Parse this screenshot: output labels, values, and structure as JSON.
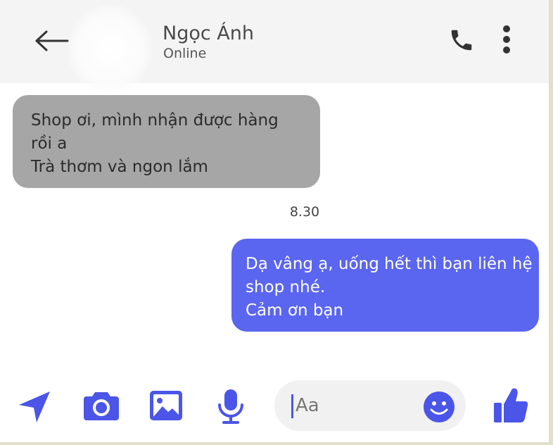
{
  "header": {
    "contact_name": "Ngọc Ánh",
    "status": "Online",
    "icons": [
      "back-arrow-icon",
      "phone-icon",
      "more-vertical-icon"
    ]
  },
  "messages": [
    {
      "direction": "incoming",
      "lines": [
        "Shop ơi, mình nhận được hàng",
        "rồi a",
        "Trà thơm và ngon lắm"
      ]
    },
    {
      "direction": "outgoing",
      "lines": [
        "Dạ vâng ạ, uống hết thì bạn liên hệ",
        "shop nhé.",
        "Cảm ơn bạn"
      ]
    }
  ],
  "timestamp": "8.30",
  "composer": {
    "placeholder": "Aa",
    "icons": [
      "send-location-icon",
      "camera-icon",
      "image-icon",
      "microphone-icon",
      "emoji-icon",
      "thumbs-up-icon"
    ]
  },
  "colors": {
    "accent": "#4b55e8",
    "outgoing_bubble": "#5a65f0",
    "incoming_bubble": "#a6a6a6",
    "header_bg": "#f4f4f4"
  }
}
